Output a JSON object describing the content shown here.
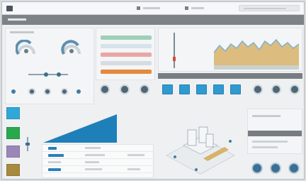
{
  "colors": {
    "accent_blue": "#2e9ad0",
    "dark_button": "#4e6675",
    "navbar": "#7d8287",
    "tile_cyan": "#2fa8d8",
    "tile_green": "#2aa84e",
    "tile_purple": "#9a86b8",
    "tile_gold": "#a78a3d",
    "area_chart_fill": "#d7b36a",
    "area_chart_line": "#7fb0d0"
  },
  "icons": {
    "logo": "app-logo-icon",
    "search": "search-icon",
    "round_buttons": "circle-button-icon",
    "square_buttons": "square-button-icon"
  },
  "readouts": {
    "gauge_left_fraction": 0.55,
    "gauge_right_fraction": 0.62,
    "slider_fraction": 0.5
  }
}
